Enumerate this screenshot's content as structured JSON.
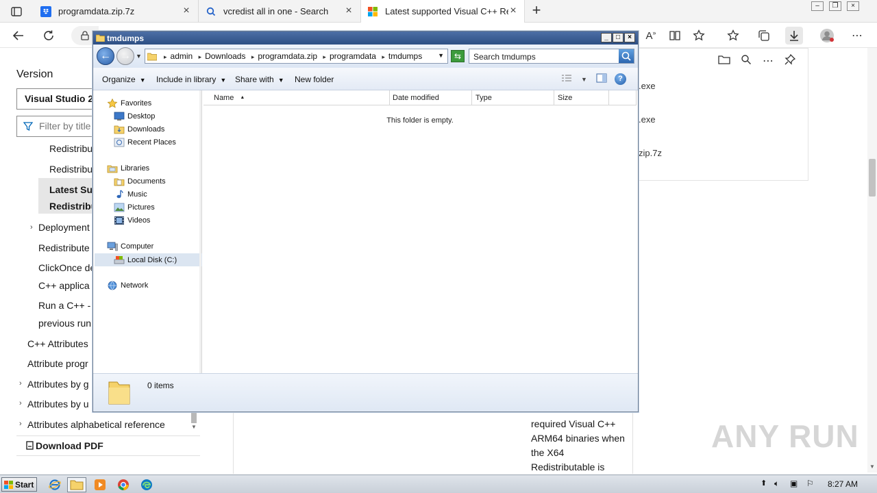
{
  "browser": {
    "tabs": [
      {
        "title": "programdata.zip.7z",
        "icon": "dropbox-icon"
      },
      {
        "title": "vcredist all in one - Search",
        "icon": "search-icon"
      },
      {
        "title": "Latest supported Visual C++ Red",
        "icon": "microsoft-icon"
      }
    ],
    "downloads": [
      ".exe",
      ".exe",
      "zip.7z"
    ]
  },
  "docs": {
    "version_label": "Version",
    "version_selected": "Visual Studio 20",
    "filter_placeholder": "Filter by title",
    "nav": [
      "Redistribu",
      "Redistribu",
      "Latest Sup",
      "Redistribu",
      "Deployment",
      "Redistribute",
      "ClickOnce de",
      "C++ applica",
      "Run a C++ -",
      "previous run",
      "C++ Attributes",
      "Attribute progr",
      "Attributes by g",
      "Attributes by u",
      "Attributes alphabetical reference"
    ],
    "download_pdf": "Download PDF",
    "body_text": [
      "required Visual C++",
      "ARM64 binaries when",
      "the X64",
      "Redistributable is"
    ]
  },
  "watermark": "ANY RUN",
  "explorer": {
    "title": "tmdumps",
    "breadcrumb": [
      "admin",
      "Downloads",
      "programdata.zip",
      "programdata",
      "tmdumps"
    ],
    "search_placeholder": "Search tmdumps",
    "commands": {
      "organize": "Organize",
      "include": "Include in library",
      "share": "Share with",
      "new_folder": "New folder"
    },
    "tree": {
      "favorites": "Favorites",
      "desktop": "Desktop",
      "downloads": "Downloads",
      "recent": "Recent Places",
      "libraries": "Libraries",
      "documents": "Documents",
      "music": "Music",
      "pictures": "Pictures",
      "videos": "Videos",
      "computer": "Computer",
      "local_disk": "Local Disk (C:)",
      "network": "Network"
    },
    "columns": {
      "name": "Name",
      "date": "Date modified",
      "type": "Type",
      "size": "Size"
    },
    "empty_message": "This folder is empty.",
    "item_count": "0 items"
  },
  "taskbar": {
    "start": "Start",
    "clock": "8:27 AM"
  }
}
